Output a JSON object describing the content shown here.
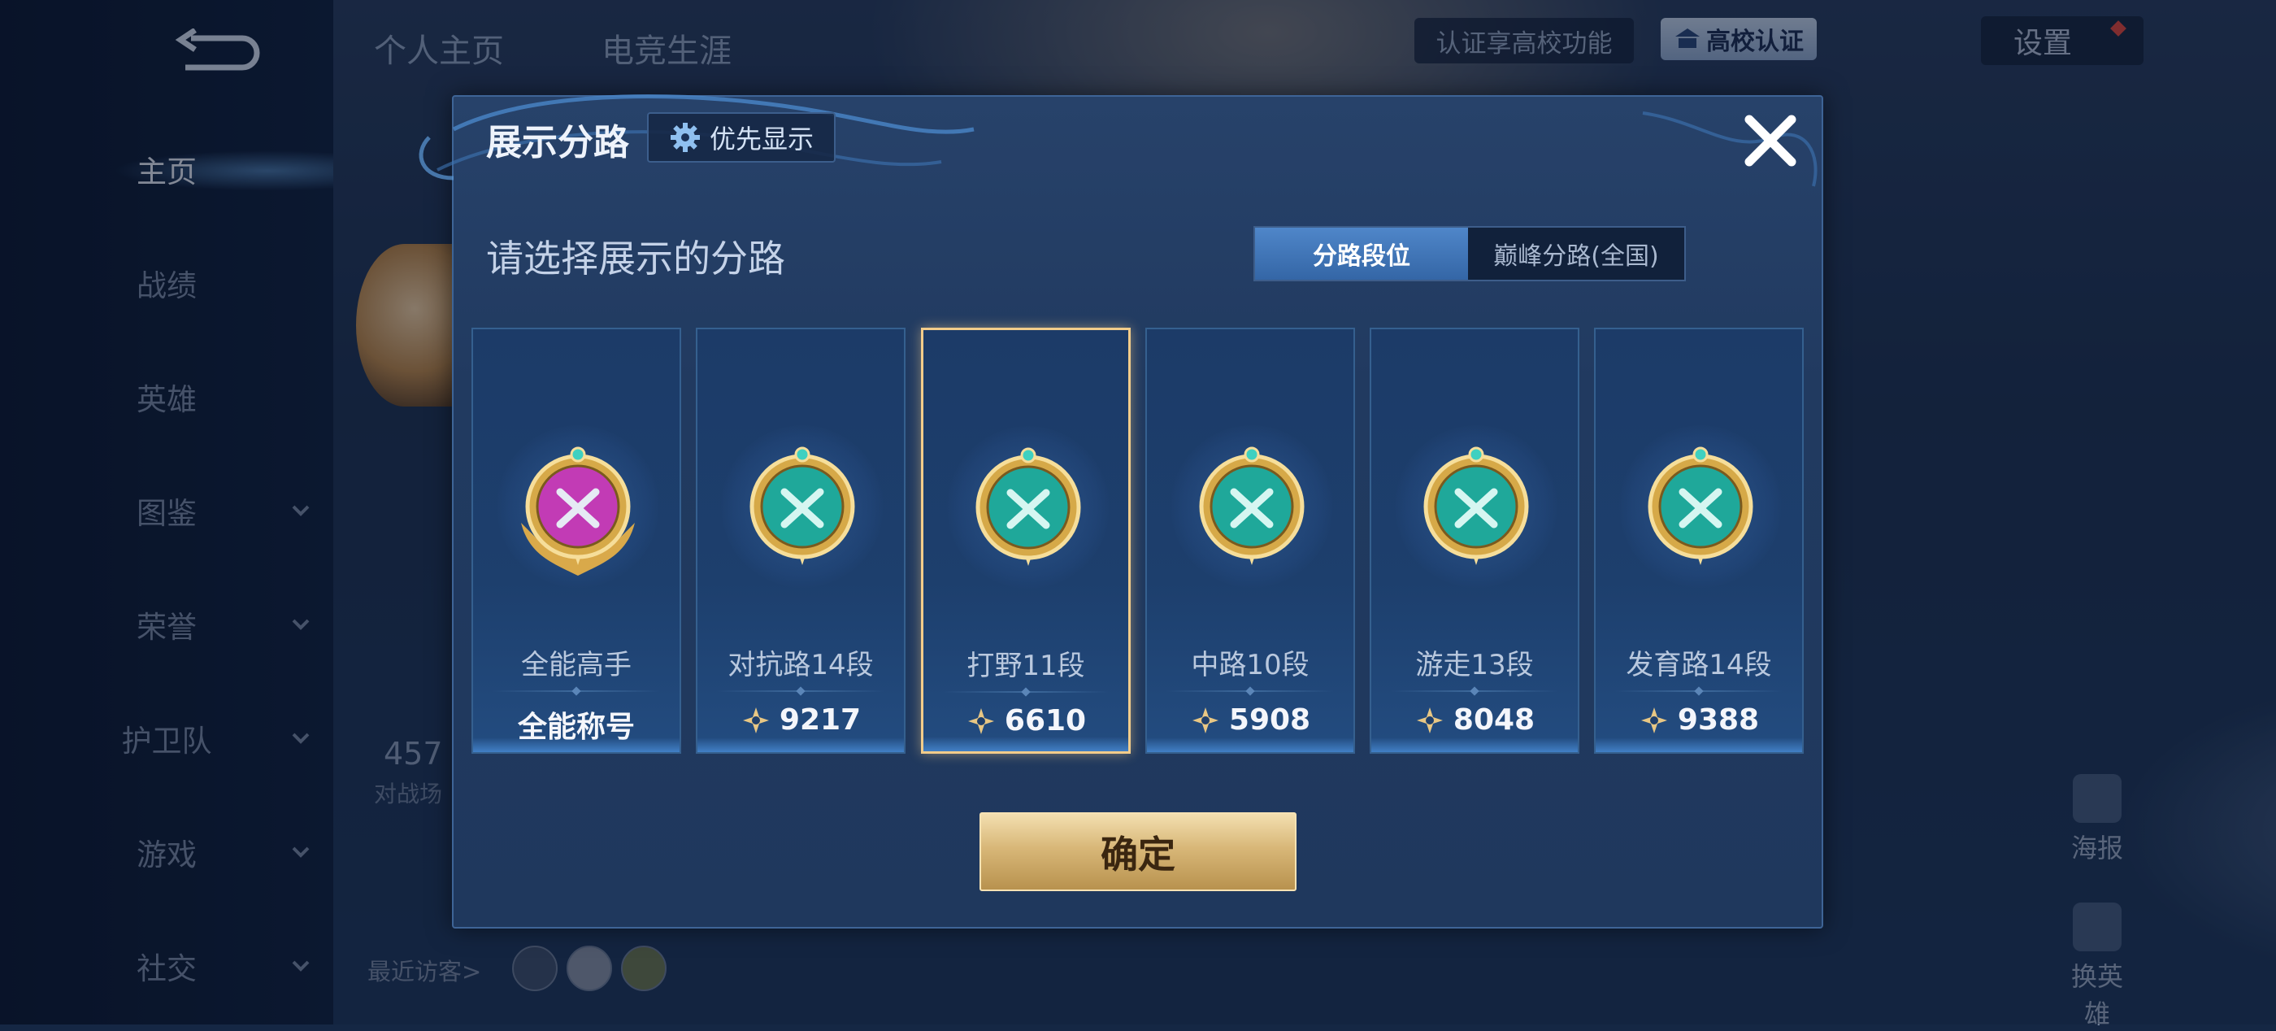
{
  "sidebar": {
    "items": [
      {
        "label": "主页",
        "active": true,
        "dropdown": false
      },
      {
        "label": "战绩",
        "active": false,
        "dropdown": false
      },
      {
        "label": "英雄",
        "active": false,
        "dropdown": false
      },
      {
        "label": "图鉴",
        "active": false,
        "dropdown": true
      },
      {
        "label": "荣誉",
        "active": false,
        "dropdown": true
      },
      {
        "label": "护卫队",
        "active": false,
        "dropdown": true
      },
      {
        "label": "游戏",
        "active": false,
        "dropdown": true
      },
      {
        "label": "社交",
        "active": false,
        "dropdown": true
      }
    ]
  },
  "topbar": {
    "tabs": [
      "个人主页",
      "电竞生涯"
    ],
    "cert_text": "认证享高校功能",
    "campus_cert": "高校认证",
    "settings": "设置"
  },
  "profile": {
    "stat_value": "457",
    "stat_label": "对战场",
    "recent_visitors": "最近访客>"
  },
  "right_actions": {
    "poster": "海报",
    "switch_hero": "换英雄"
  },
  "dialog": {
    "title": "展示分路",
    "priority_button": "优先显示",
    "subtitle": "请选择展示的分路",
    "segments": [
      "分路段位",
      "巅峰分路(全国)"
    ],
    "active_segment": 0,
    "cards": [
      {
        "lane": "全能高手",
        "value": "全能称号",
        "has_points": false,
        "selected": false,
        "badge_color": "#c23bb5"
      },
      {
        "lane": "对抗路14段",
        "value": "9217",
        "has_points": true,
        "selected": false,
        "badge_color": "#1fa89a"
      },
      {
        "lane": "打野11段",
        "value": "6610",
        "has_points": true,
        "selected": true,
        "badge_color": "#1fa89a"
      },
      {
        "lane": "中路10段",
        "value": "5908",
        "has_points": true,
        "selected": false,
        "badge_color": "#1fa89a"
      },
      {
        "lane": "游走13段",
        "value": "8048",
        "has_points": true,
        "selected": false,
        "badge_color": "#1fa89a"
      },
      {
        "lane": "发育路14段",
        "value": "9388",
        "has_points": true,
        "selected": false,
        "badge_color": "#1fa89a"
      }
    ],
    "confirm": "确定"
  },
  "colors": {
    "accent_gold": "#d8b778",
    "selected_border": "#f2cc8a",
    "active_segment": "#3f76b8"
  }
}
